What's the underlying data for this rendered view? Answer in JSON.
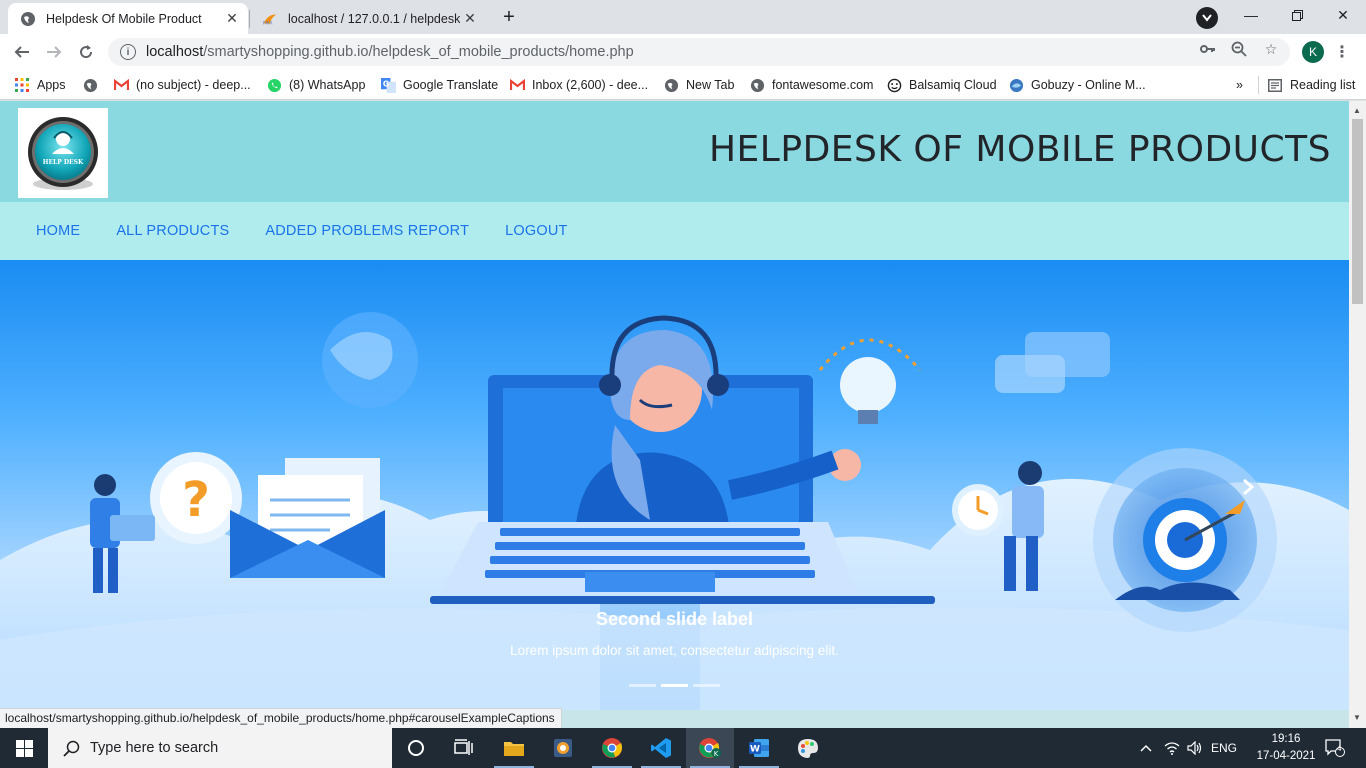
{
  "browser": {
    "tabs": [
      {
        "title": "Helpdesk Of Mobile Product",
        "active": true
      },
      {
        "title": "localhost / 127.0.0.1 / helpdesk /",
        "active": false
      }
    ],
    "url_host": "localhost",
    "url_path": "/smartyshopping.github.io/helpdesk_of_mobile_products/home.php",
    "profile_initial": "K",
    "bookmarks": [
      {
        "label": "Apps",
        "icon": "apps-grid-icon"
      },
      {
        "label": "",
        "icon": "globe-icon"
      },
      {
        "label": "(no subject) - deep...",
        "icon": "gmail-icon"
      },
      {
        "label": "(8) WhatsApp",
        "icon": "whatsapp-icon"
      },
      {
        "label": "Google Translate",
        "icon": "translate-icon"
      },
      {
        "label": "Inbox (2,600) - dee...",
        "icon": "gmail-icon"
      },
      {
        "label": "New Tab",
        "icon": "globe-icon"
      },
      {
        "label": "fontawesome.com",
        "icon": "globe-icon"
      },
      {
        "label": "Balsamiq Cloud",
        "icon": "smiley-icon"
      },
      {
        "label": "Gobuzy - Online M...",
        "icon": "gobuzy-icon"
      }
    ],
    "overflow": "»",
    "reading_list": "Reading list",
    "status_url": "localhost/smartyshopping.github.io/helpdesk_of_mobile_products/home.php#carouselExampleCaptions"
  },
  "site": {
    "title": "HELPDESK OF MOBILE PRODUCTS",
    "logo_text": "HELP DESK",
    "nav": [
      "HOME",
      "ALL PRODUCTS",
      "ADDED PROBLEMS REPORT",
      "LOGOUT"
    ],
    "carousel": {
      "caption_title": "Second slide label",
      "caption_text": "Lorem ipsum dolor sit amet, consectetur adipiscing elit.",
      "slide_count": 3,
      "active_slide": 2
    }
  },
  "taskbar": {
    "search_placeholder": "Type here to search",
    "language": "ENG",
    "time": "19:16",
    "date": "17-04-2021",
    "notifications": "4"
  },
  "colors": {
    "header_bg": "#8ad9e0",
    "nav_bg": "#b0ecee",
    "nav_link": "#1a73e8",
    "hero_blue": "#1e90ff"
  }
}
